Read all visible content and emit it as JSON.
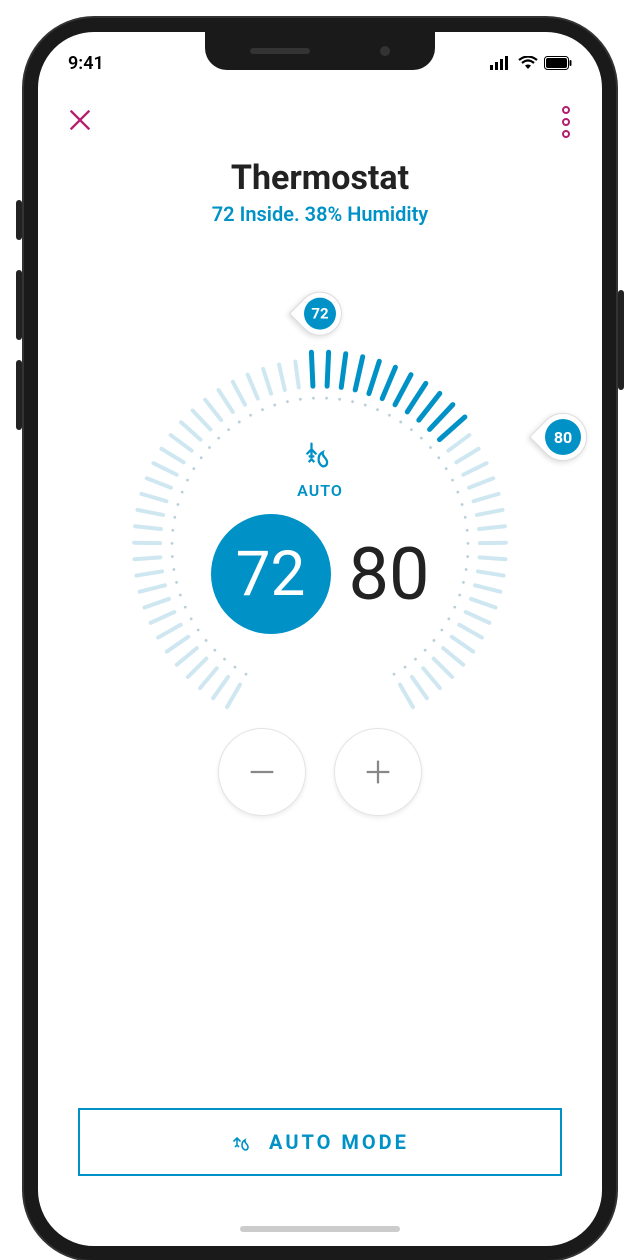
{
  "status": {
    "time": "9:41"
  },
  "header": {
    "title": "Thermostat",
    "subtitle": "72 Inside. 38% Humidity"
  },
  "thermostat": {
    "mode_label": "AUTO",
    "low_setpoint": "72",
    "high_setpoint": "80",
    "marker_low": "72",
    "marker_high": "80"
  },
  "footer": {
    "mode_button_label": "AUTO MODE"
  },
  "colors": {
    "accent": "#0092c7",
    "magenta": "#b51e6f"
  }
}
